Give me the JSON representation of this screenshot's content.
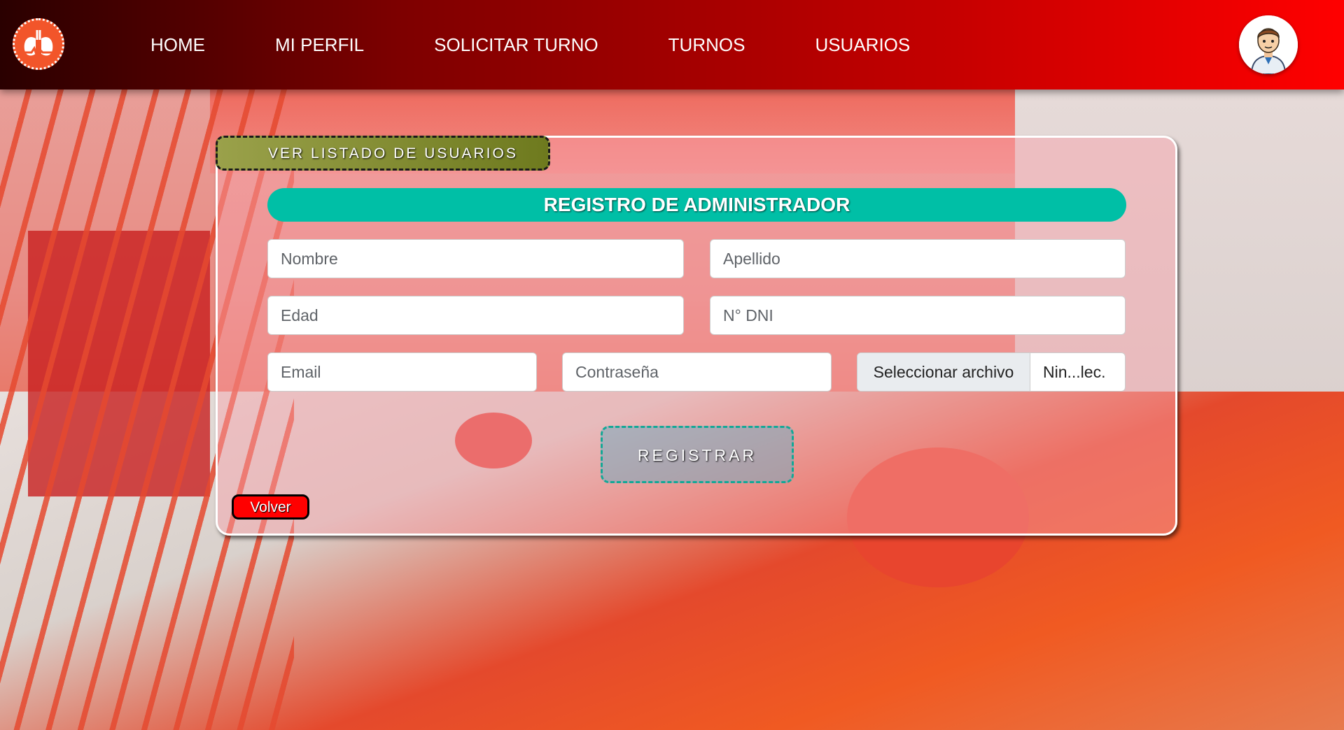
{
  "nav": {
    "links": [
      "HOME",
      "MI PERFIL",
      "SOLICITAR TURNO",
      "TURNOS",
      "USUARIOS"
    ]
  },
  "form": {
    "list_button": "VER LISTADO DE USUARIOS",
    "title": "REGISTRO DE ADMINISTRADOR",
    "placeholders": {
      "nombre": "Nombre",
      "apellido": "Apellido",
      "edad": "Edad",
      "dni": "N° DNI",
      "email": "Email",
      "password": "Contraseña"
    },
    "file_button": "Seleccionar archivo",
    "file_name": "Nin...lec.",
    "register_button": "REGISTRAR",
    "back_button": "Volver"
  },
  "colors": {
    "nav_gradient_start": "#2a0000",
    "nav_gradient_end": "#ff0000",
    "title_bar": "#00bfa6",
    "list_button": "#7e8a2a",
    "back_button": "#ff0000"
  },
  "icons": {
    "logo": "lungs-heartbeat-icon",
    "avatar": "doctor-avatar-icon"
  }
}
